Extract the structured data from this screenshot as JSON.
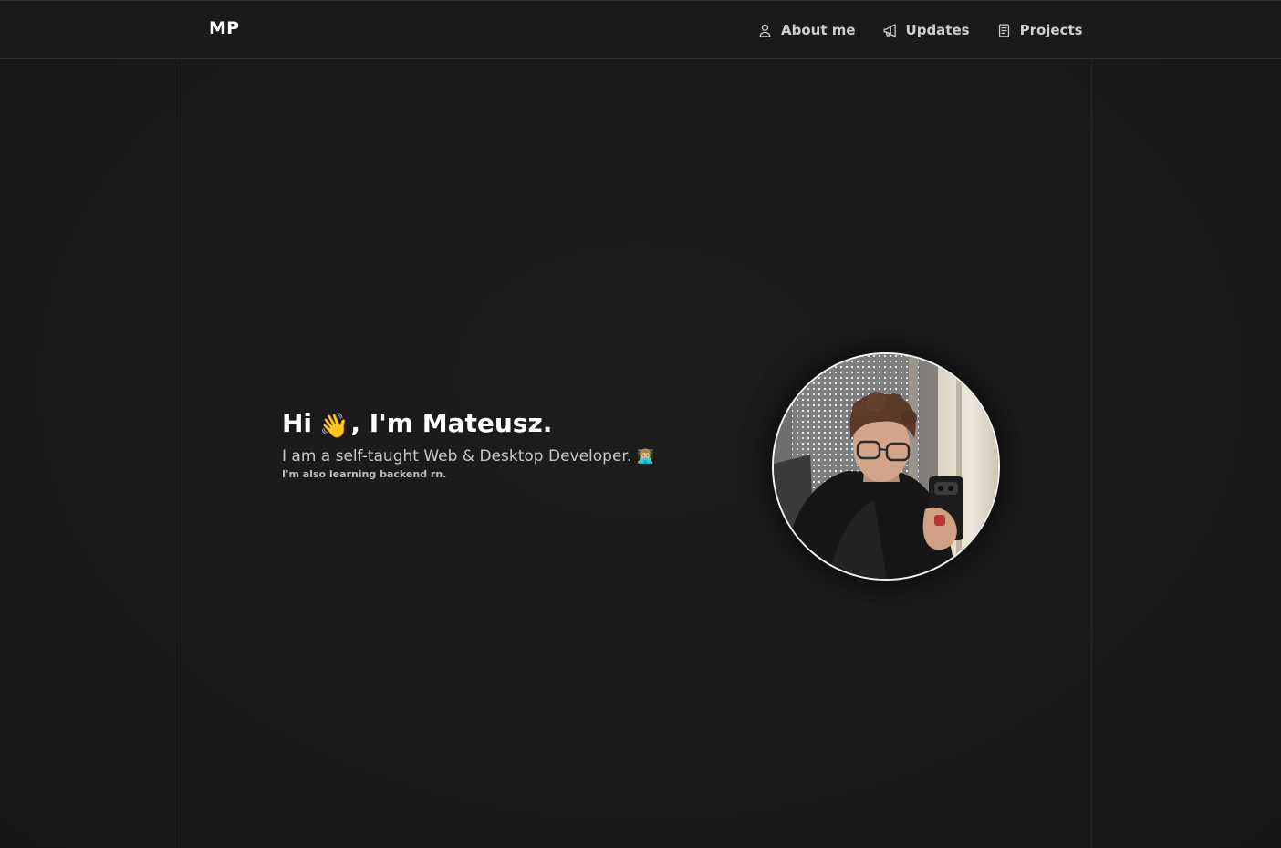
{
  "brand": "MP",
  "nav": {
    "about": {
      "label": "About me",
      "icon": "user-icon"
    },
    "updates": {
      "label": "Updates",
      "icon": "megaphone-icon"
    },
    "projects": {
      "label": "Projects",
      "icon": "document-icon"
    }
  },
  "hero": {
    "greeting_before": "Hi",
    "wave_emoji": "👋",
    "greeting_after": ", I'm Mateusz.",
    "subtitle": "I am a self-taught Web & Desktop Developer.",
    "dev_emoji": "👨🏼‍💻",
    "note": "I'm also learning backend rn."
  },
  "colors": {
    "background": "#1b1b1b",
    "navbar": "#1a1a1a",
    "text_primary": "#ffffff",
    "text_secondary": "#c8c8c8",
    "avatar_border": "#f2f2f2"
  }
}
